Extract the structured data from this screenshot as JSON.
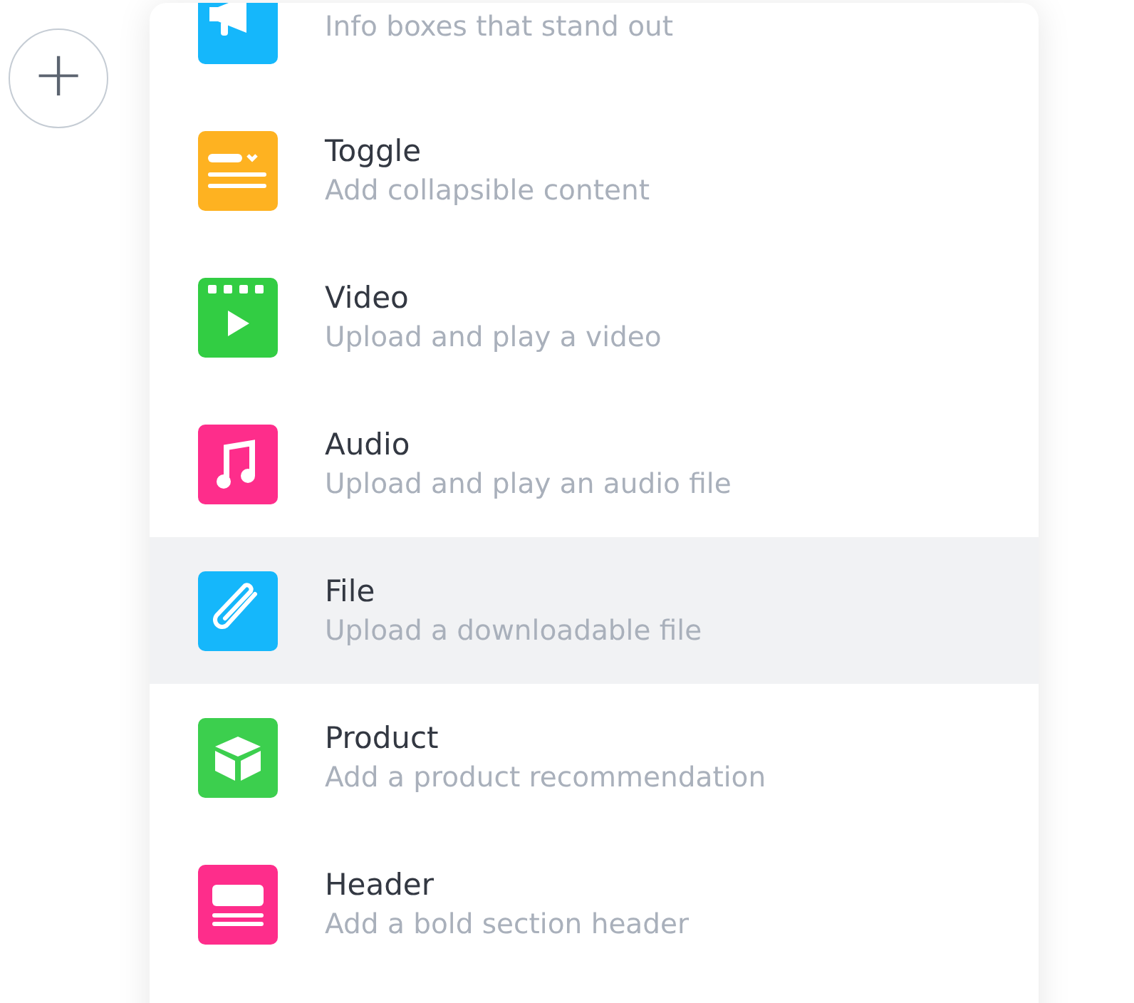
{
  "add_button": {
    "label": "+"
  },
  "block_menu": {
    "items": [
      {
        "kind": "callout",
        "description": "Info boxes that stand out",
        "color": "#15b7fb",
        "selected": false
      },
      {
        "kind": "toggle",
        "title": "Toggle",
        "description": "Add collapsible content",
        "color": "#feb221",
        "selected": false
      },
      {
        "kind": "video",
        "title": "Video",
        "description": "Upload and play a video",
        "color": "#32cd43",
        "selected": false
      },
      {
        "kind": "audio",
        "title": "Audio",
        "description": "Upload and play an audio file",
        "color": "#fe2d8b",
        "selected": false
      },
      {
        "kind": "file",
        "title": "File",
        "description": "Upload a downloadable file",
        "color": "#15b7fb",
        "selected": true
      },
      {
        "kind": "product",
        "title": "Product",
        "description": "Add a product recommendation",
        "color": "#3ccf4e",
        "selected": false
      },
      {
        "kind": "header",
        "title": "Header",
        "description": "Add a bold section header",
        "color": "#fe2d8b",
        "selected": false
      }
    ]
  }
}
